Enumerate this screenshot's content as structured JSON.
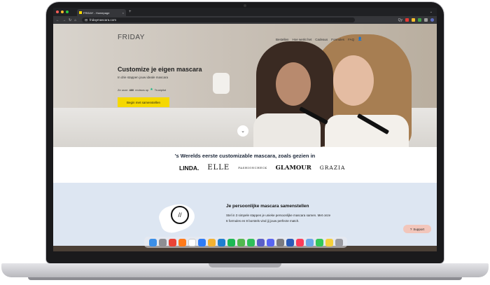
{
  "browser": {
    "tab_title": "FRIDAY - Homepage",
    "url": "fridaymascara.com",
    "new_tab": "+",
    "close": "×",
    "tabs_menu": "⌄",
    "back": "←",
    "forward": "→",
    "reload": "↻",
    "home": "⌂",
    "lock": "⊟",
    "zoom_label": "Qy"
  },
  "site": {
    "logo": "FRIDAY",
    "nav": [
      "Bestellen",
      "Hoe werkt het",
      "Cadeaus",
      "Formules",
      "FAQ"
    ],
    "user_icon": "👤",
    "hero_title": "Customize je eigen mascara",
    "hero_subtitle": "In drie stappen jouw ideale mascara",
    "rating_prefix": "Ze onze",
    "rating_count": "480",
    "rating_suffix": "reviews op",
    "rating_brand": "Trustpilot",
    "rating_star": "★",
    "cta": "Begin met samenstellen",
    "scroll_down": "⌄",
    "press_title": "'s Werelds eerste customizable mascara, zoals gezien in",
    "press": [
      "LINDA.",
      "ELLE",
      "FASHIONCHECK",
      "GLAMOUR",
      "GRAZIA"
    ],
    "section_title": "Je persoonlijke mascara samenstellen",
    "section_body": "Stel in 3 simpele stappen je unieke persoonlijke mascara samen. Met onze 6 formules en 8 borstels vind jij jouw perfecte match.",
    "section_icon": "//",
    "support": "Support",
    "support_icon": "?"
  },
  "dock_apps": [
    {
      "name": "finder-icon",
      "color": "#3b8fe8"
    },
    {
      "name": "launchpad-icon",
      "color": "#8e8e93"
    },
    {
      "name": "chrome-icon",
      "color": "#e94335"
    },
    {
      "name": "firefox-icon",
      "color": "#ff7a1a"
    },
    {
      "name": "calendar-icon",
      "color": "#ffffff"
    },
    {
      "name": "mail-icon",
      "color": "#2f7cf6"
    },
    {
      "name": "photos-icon",
      "color": "#f2b233"
    },
    {
      "name": "vscode-icon",
      "color": "#1f7fd1"
    },
    {
      "name": "spotify-icon",
      "color": "#1db954"
    },
    {
      "name": "maps-icon",
      "color": "#52b84f"
    },
    {
      "name": "facetime-icon",
      "color": "#2fbf5a"
    },
    {
      "name": "teams-icon",
      "color": "#5b5fc7"
    },
    {
      "name": "discord-icon",
      "color": "#5865f2"
    },
    {
      "name": "settings-icon",
      "color": "#7a7a80"
    },
    {
      "name": "word-icon",
      "color": "#2b5bb8"
    },
    {
      "name": "music-icon",
      "color": "#fb3c5a"
    },
    {
      "name": "preview-icon",
      "color": "#6aa7e8"
    },
    {
      "name": "messages-icon",
      "color": "#34c759"
    },
    {
      "name": "notes-icon",
      "color": "#f5cf3b"
    },
    {
      "name": "trash-icon",
      "color": "#9a9aa0"
    }
  ],
  "colors": {
    "accent": "#f5d800",
    "trustpilot": "#00b67a",
    "section_bg": "#dde6f2",
    "support_bg": "#f2c6bb"
  }
}
